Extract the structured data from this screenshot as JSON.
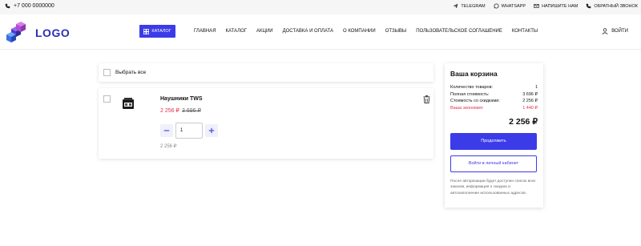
{
  "topbar": {
    "phone": "+7 000 0000000",
    "links": [
      {
        "label": "TELEGRAM",
        "icon": "telegram-icon"
      },
      {
        "label": "WHATSAPP",
        "icon": "whatsapp-icon"
      },
      {
        "label": "НАПИШИТЕ НАМ",
        "icon": "mail-icon"
      },
      {
        "label": "ОБРАТНЫЙ ЗВОНОК",
        "icon": "phone-callback-icon"
      }
    ]
  },
  "header": {
    "logo_text": "LOGO",
    "catalog_label": "КАТАЛОГ",
    "nav": [
      "ГЛАВНАЯ",
      "КАТАЛОГ",
      "АКЦИИ",
      "ДОСТАВКА И ОПЛАТА",
      "О КОМПАНИИ",
      "ОТЗЫВЫ",
      "ПОЛЬЗОВАТЕЛЬСКОЕ СОГЛАШЕНИЕ",
      "КОНТАКТЫ"
    ],
    "login_label": "ВОЙТИ"
  },
  "cart": {
    "select_all_label": "Выбрать все",
    "item": {
      "name": "Наушники TWS",
      "price": "2 256 ₽",
      "old_price": "3 696 ₽",
      "quantity": "1",
      "subtotal": "2 256 ₽"
    }
  },
  "summary": {
    "title": "Ваша корзина",
    "rows": [
      {
        "label": "Количество товаров:",
        "value": "1"
      },
      {
        "label": "Полная стоимость:",
        "value": "3 696 ₽"
      },
      {
        "label": "Стоимость со скидками:",
        "value": "2 256 ₽"
      },
      {
        "label": "Ваша экономия:",
        "value": "1 440 ₽"
      }
    ],
    "total": "2 256 ₽",
    "continue_label": "Продолжить",
    "login_label": "Войти в личный кабинет",
    "note": "После авторизации будет доступен список всех заказов, информация о скидках и автозаполнение использованных адресов."
  },
  "colors": {
    "accent": "#3b3be8",
    "price_red": "#e0304a"
  }
}
